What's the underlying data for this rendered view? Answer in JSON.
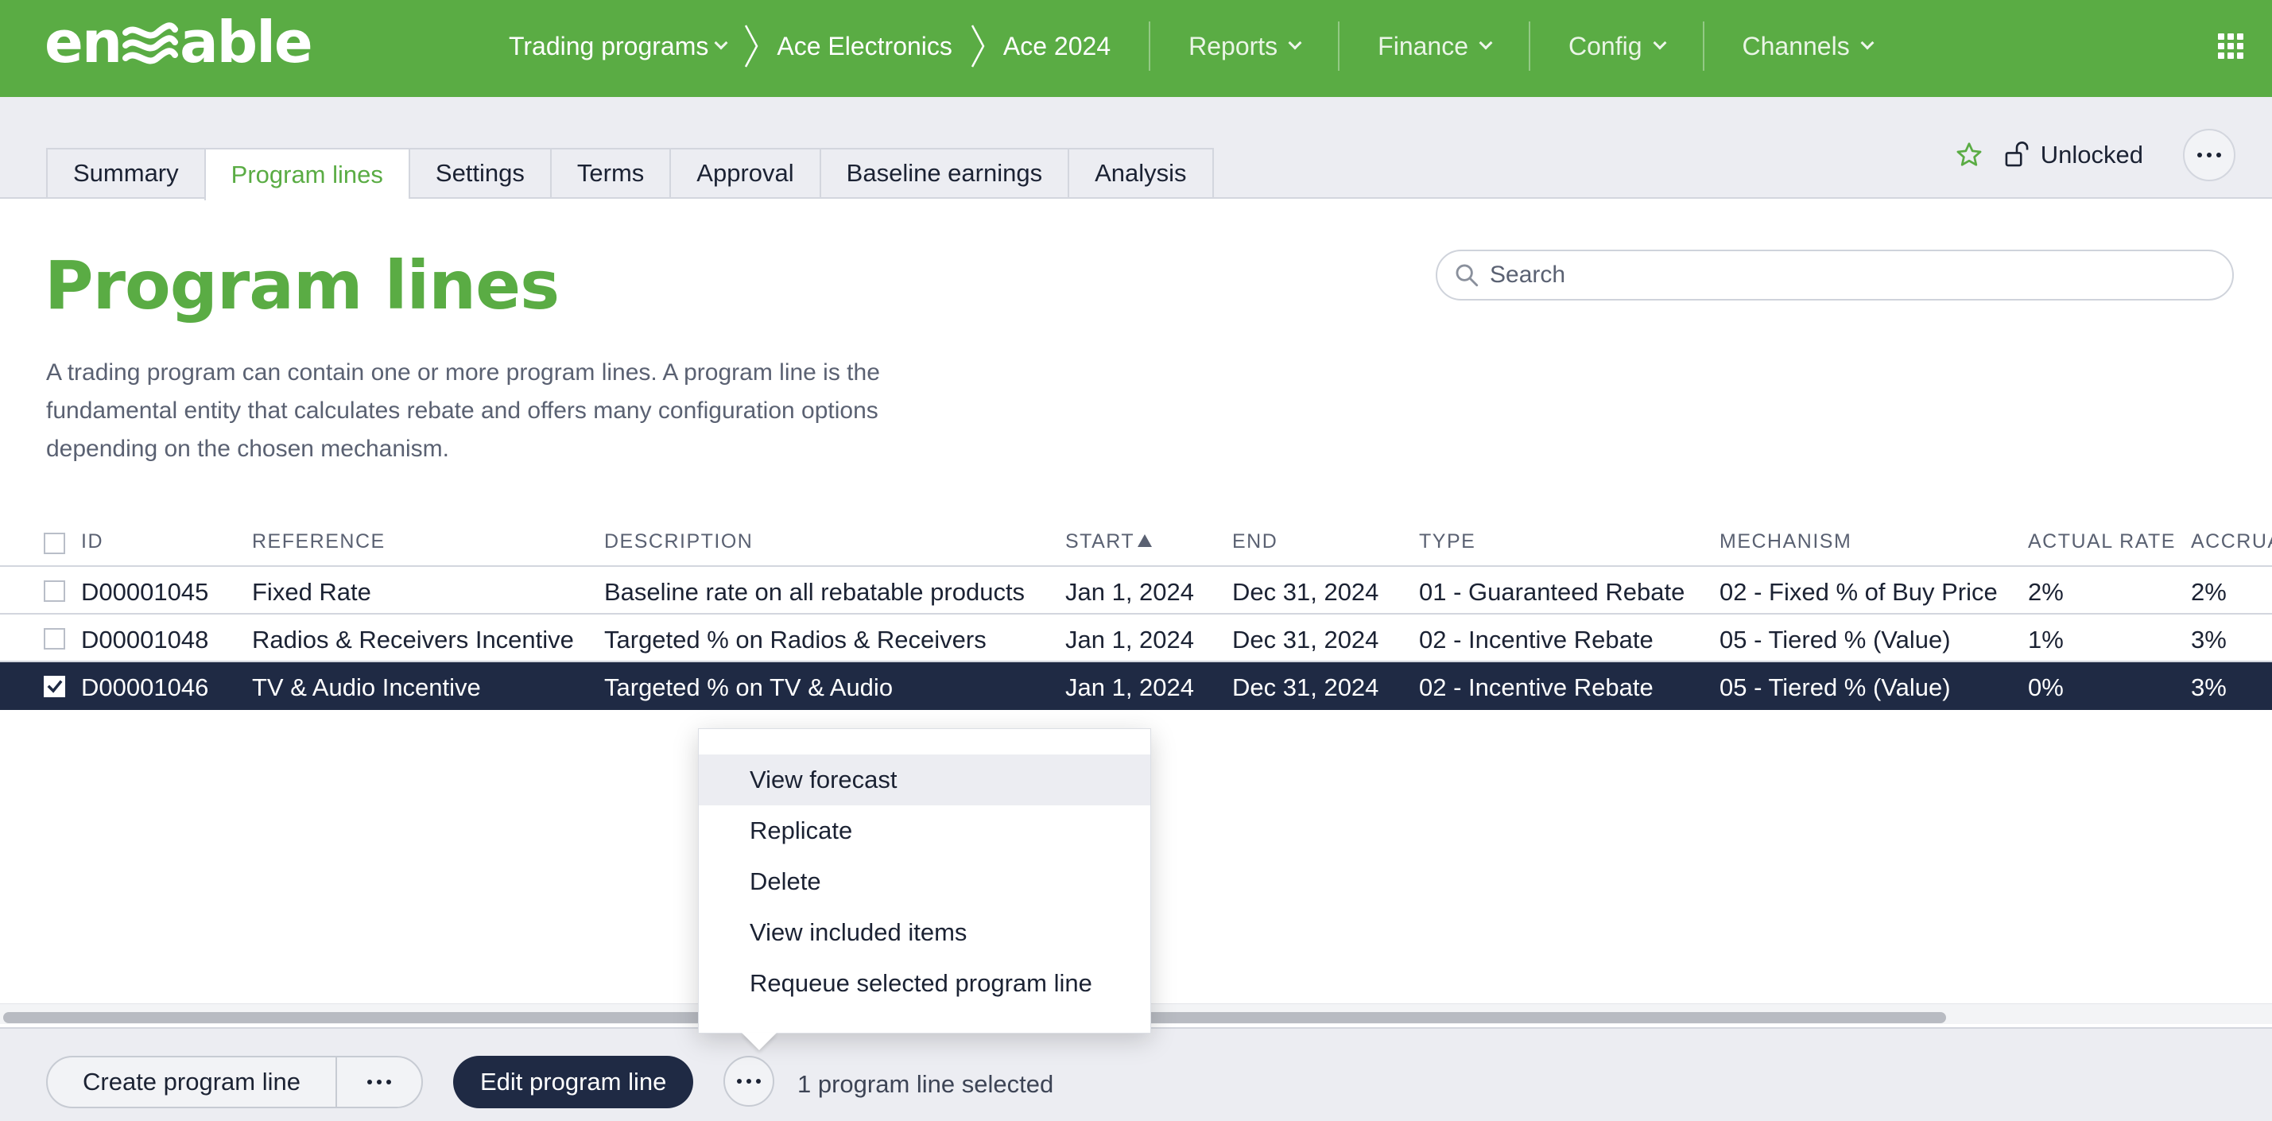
{
  "app": {
    "logo_text": "enable",
    "brand_color": "#5aac44",
    "navy_color": "#1f2a44"
  },
  "breadcrumb": {
    "trading_programs": "Trading programs",
    "company": "Ace Electronics",
    "program": "Ace 2024"
  },
  "nav": {
    "reports": "Reports",
    "finance": "Finance",
    "config": "Config",
    "channels": "Channels"
  },
  "tabs": [
    {
      "label": "Summary"
    },
    {
      "label": "Program lines"
    },
    {
      "label": "Settings"
    },
    {
      "label": "Terms"
    },
    {
      "label": "Approval"
    },
    {
      "label": "Baseline earnings"
    },
    {
      "label": "Analysis"
    }
  ],
  "status": {
    "lock_label": "Unlocked"
  },
  "page": {
    "title": "Program lines",
    "description": "A trading program can contain one or more program lines. A program line is the fundamental entity that calculates rebate and offers many configuration options depending on the chosen mechanism."
  },
  "search": {
    "placeholder": "Search"
  },
  "table": {
    "columns": [
      "ID",
      "REFERENCE",
      "DESCRIPTION",
      "START",
      "END",
      "TYPE",
      "MECHANISM",
      "ACTUAL RATE",
      "ACCRUA"
    ],
    "sorted_column": "START",
    "rows": [
      {
        "id": "D00001045",
        "reference": "Fixed Rate",
        "description": "Baseline rate on all rebatable products",
        "start": "Jan 1, 2024",
        "end": "Dec 31, 2024",
        "type": "01 - Guaranteed Rebate",
        "mechanism": "02 - Fixed % of Buy Price",
        "actual_rate": "2%",
        "accrual": "2%",
        "selected": false
      },
      {
        "id": "D00001048",
        "reference": "Radios & Receivers Incentive",
        "description": "Targeted % on Radios & Receivers",
        "start": "Jan 1, 2024",
        "end": "Dec 31, 2024",
        "type": "02 - Incentive Rebate",
        "mechanism": "05 - Tiered % (Value)",
        "actual_rate": "1%",
        "accrual": "3%",
        "selected": false
      },
      {
        "id": "D00001046",
        "reference": "TV & Audio Incentive",
        "description": "Targeted % on TV & Audio",
        "start": "Jan 1, 2024",
        "end": "Dec 31, 2024",
        "type": "02 - Incentive Rebate",
        "mechanism": "05 - Tiered % (Value)",
        "actual_rate": "0%",
        "accrual": "3%",
        "selected": true
      }
    ]
  },
  "context_menu": {
    "items": [
      "View forecast",
      "Replicate",
      "Delete",
      "View included items",
      "Requeue selected program line"
    ]
  },
  "footer": {
    "create_label": "Create program line",
    "edit_label": "Edit program line",
    "selection_text": "1 program line selected"
  }
}
